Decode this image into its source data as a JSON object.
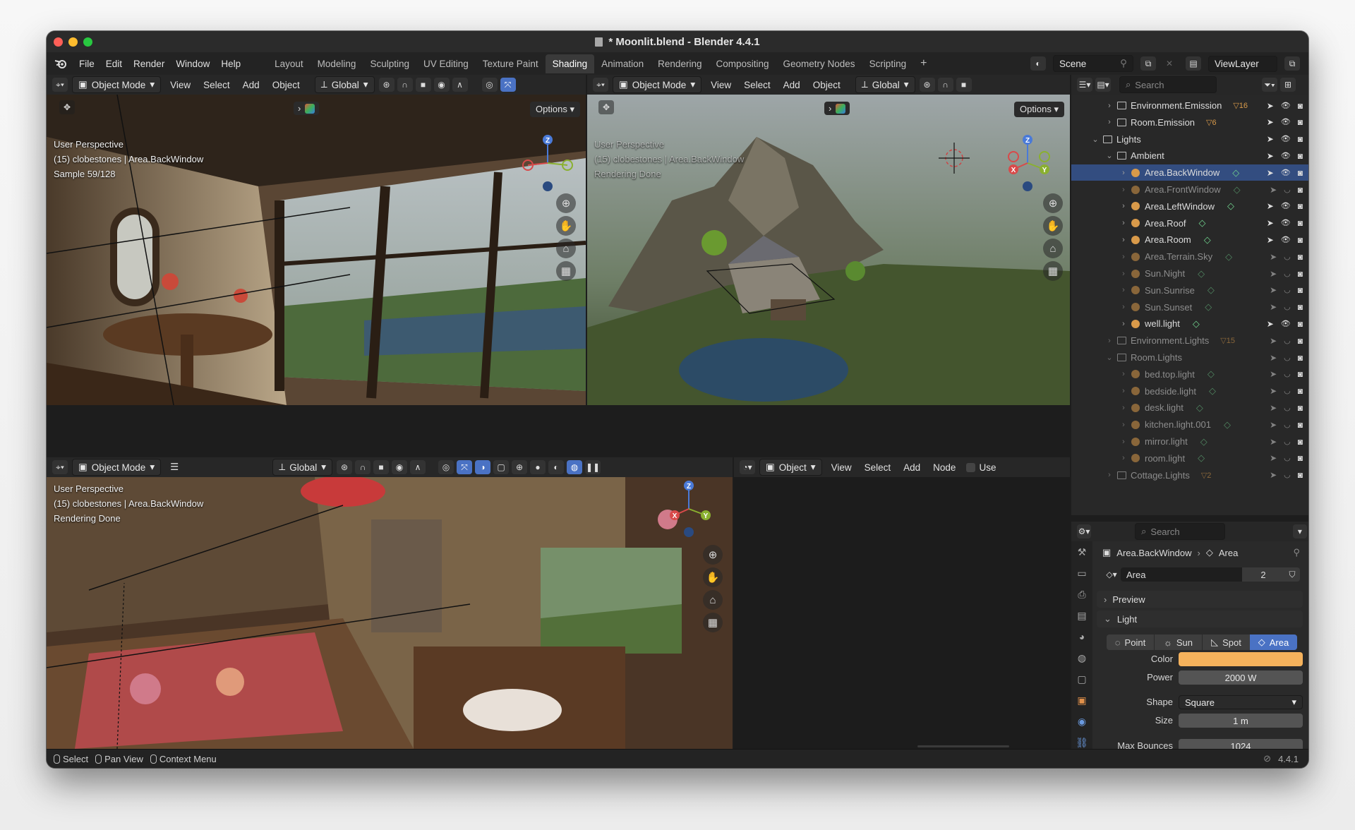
{
  "window": {
    "title": "* Moonlit.blend - Blender 4.4.1"
  },
  "menu": [
    "File",
    "Edit",
    "Render",
    "Window",
    "Help"
  ],
  "workspaces": [
    "Layout",
    "Modeling",
    "Sculpting",
    "UV Editing",
    "Texture Paint",
    "Shading",
    "Animation",
    "Rendering",
    "Compositing",
    "Geometry Nodes",
    "Scripting"
  ],
  "active_workspace": "Shading",
  "scene": {
    "name": "Scene",
    "view_layer": "ViewLayer"
  },
  "viewport_header": {
    "mode": "Object Mode",
    "view": "View",
    "select": "Select",
    "add": "Add",
    "object": "Object",
    "transform": "Global",
    "options": "Options"
  },
  "viewport_tl": {
    "line1": "User Perspective",
    "line2": "(15) clobestones | Area.BackWindow",
    "line3": "Sample 59/128"
  },
  "viewport_tr": {
    "line1": "User Perspective",
    "line2": "(15) clobestones | Area.BackWindow",
    "line3": "Rendering Done"
  },
  "viewport_bl": {
    "line1": "User Perspective",
    "line2": "(15) clobestones | Area.BackWindow",
    "line3": "Rendering Done"
  },
  "gizmo": {
    "x": "X",
    "y": "Y",
    "z": "Z"
  },
  "node_editor": {
    "type": "Object",
    "view": "View",
    "select": "Select",
    "add": "Add",
    "node": "Node",
    "use": "Use"
  },
  "outliner": {
    "search_placeholder": "Search",
    "rows": [
      {
        "label": "Environment.Emission",
        "badge": "16"
      },
      {
        "label": "Room.Emission",
        "badge": "6"
      },
      {
        "label": "Lights",
        "badge": ""
      },
      {
        "label": "Ambient",
        "badge": ""
      },
      {
        "label": "Area.BackWindow",
        "badge": ""
      },
      {
        "label": "Area.FrontWindow",
        "badge": ""
      },
      {
        "label": "Area.LeftWindow",
        "badge": ""
      },
      {
        "label": "Area.Roof",
        "badge": ""
      },
      {
        "label": "Area.Room",
        "badge": ""
      },
      {
        "label": "Area.Terrain.Sky",
        "badge": ""
      },
      {
        "label": "Sun.Night",
        "badge": ""
      },
      {
        "label": "Sun.Sunrise",
        "badge": ""
      },
      {
        "label": "Sun.Sunset",
        "badge": ""
      },
      {
        "label": "well.light",
        "badge": ""
      },
      {
        "label": "Environment.Lights",
        "badge": "15"
      },
      {
        "label": "Room.Lights",
        "badge": ""
      },
      {
        "label": "bed.top.light",
        "badge": ""
      },
      {
        "label": "bedside.light",
        "badge": ""
      },
      {
        "label": "desk.light",
        "badge": ""
      },
      {
        "label": "kitchen.light.001",
        "badge": ""
      },
      {
        "label": "mirror.light",
        "badge": ""
      },
      {
        "label": "room.light",
        "badge": ""
      },
      {
        "label": "Cottage.Lights",
        "badge": "2"
      }
    ]
  },
  "properties": {
    "search_placeholder": "Search",
    "breadcrumb_object": "Area.BackWindow",
    "breadcrumb_data": "Area",
    "datablock": "Area",
    "users": "2",
    "preview": "Preview",
    "light_panel": "Light",
    "light_types": [
      "Point",
      "Sun",
      "Spot",
      "Area"
    ],
    "color_label": "Color",
    "color_value": "#f5b25c",
    "power_label": "Power",
    "power_value": "2000 W",
    "shape_label": "Shape",
    "shape_value": "Square",
    "size_label": "Size",
    "size_value": "1 m",
    "max_bounces_label": "Max Bounces",
    "max_bounces_value": "1024"
  },
  "status_bar": {
    "select": "Select",
    "pan": "Pan View",
    "context": "Context Menu",
    "version": "4.4.1"
  },
  "colors": {
    "accent": "#4a72c4",
    "selected_row": "#334d80",
    "light_icon": "#d99a4a",
    "active_tab": "#6fd08c"
  }
}
